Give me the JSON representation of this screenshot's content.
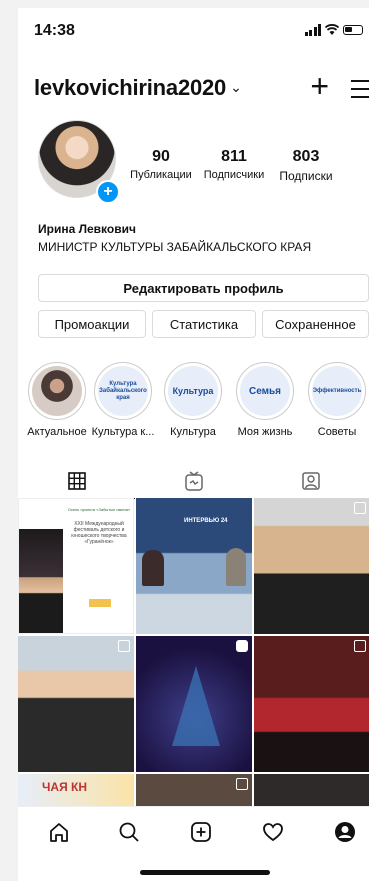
{
  "status": {
    "time": "14:38"
  },
  "header": {
    "username": "levkovichirina2020",
    "chevron": "⌄"
  },
  "stats": [
    {
      "num": "90",
      "label": "Публикации"
    },
    {
      "num": "811",
      "label": "Подписчики"
    },
    {
      "num": "803",
      "label": "Подписки"
    }
  ],
  "profile": {
    "name": "Ирина Левкович",
    "bio": "МИНИСТР КУЛЬТУРЫ ЗАБАЙКАЛЬСКОГО КРАЯ",
    "edit_label": "Редактировать профиль",
    "promo_label": "Промоакции",
    "stats_label": "Статистика",
    "saved_label": "Сохраненное"
  },
  "highlights": [
    {
      "label": "Актуальное",
      "cover": ""
    },
    {
      "label": "Культура к...",
      "cover": "Культура Забайкальского края"
    },
    {
      "label": "Культура",
      "cover": "Культура"
    },
    {
      "label": "Моя жизнь",
      "cover": "Семья"
    },
    {
      "label": "Советы",
      "cover": "Эффективность"
    }
  ],
  "posts": {
    "poster_head": "Осень проекта «Забытые имена»",
    "poster_title": "XXII Международный фестиваль детского и юношеского творчества «Гуранёнок»",
    "tv_logo": "ИНТЕРВЬЮ 24",
    "banner_text": "ЧАЯ КН"
  },
  "colors": {
    "accent": "#0095f6",
    "text": "#111111",
    "border": "#dbdbdb"
  }
}
